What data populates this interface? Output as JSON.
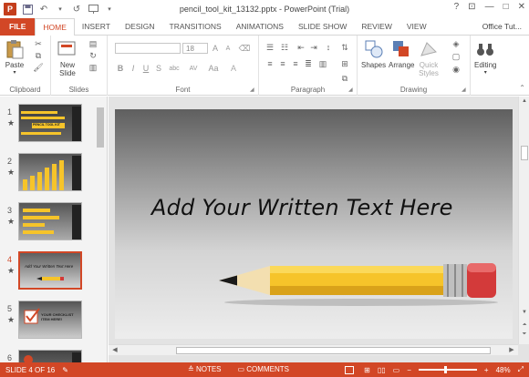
{
  "window": {
    "title": "pencil_tool_kit_13132.pptx - PowerPoint (Trial)",
    "app_logo": "P",
    "help_glyph": "?",
    "min_glyph": "—",
    "max_glyph": "□",
    "close_glyph": "✕"
  },
  "tabs": [
    {
      "label": "FILE"
    },
    {
      "label": "HOME"
    },
    {
      "label": "INSERT"
    },
    {
      "label": "DESIGN"
    },
    {
      "label": "TRANSITIONS"
    },
    {
      "label": "ANIMATIONS"
    },
    {
      "label": "SLIDE SHOW"
    },
    {
      "label": "REVIEW"
    },
    {
      "label": "VIEW"
    },
    {
      "label": "Office Tut..."
    }
  ],
  "ribbon": {
    "clipboard": {
      "group_label": "Clipboard",
      "paste_label": "Paste"
    },
    "slides": {
      "group_label": "Slides",
      "new_slide_label": "New",
      "new_slide_label2": "Slide"
    },
    "font": {
      "group_label": "Font",
      "font_size": "18",
      "bold": "B",
      "italic": "I",
      "underline": "U",
      "strike": "S",
      "shadow": "abc",
      "spacing": "AV",
      "case": "Aa",
      "grow": "A",
      "shrink": "A",
      "color": "A"
    },
    "paragraph": {
      "group_label": "Paragraph"
    },
    "drawing": {
      "group_label": "Drawing",
      "shapes_label": "Shapes",
      "arrange_label": "Arrange",
      "quick_styles_label": "Quick",
      "quick_styles_label2": "Styles"
    },
    "editing": {
      "editing_label": "Editing"
    }
  },
  "thumbnails": [
    {
      "num": "1",
      "star": "★",
      "caption": "PENCIL TOOL KIT",
      "selected": false
    },
    {
      "num": "2",
      "star": "★",
      "caption": "",
      "selected": false
    },
    {
      "num": "3",
      "star": "★",
      "caption": "",
      "selected": false
    },
    {
      "num": "4",
      "star": "★",
      "caption": "Add Your Written Text Here",
      "selected": true
    },
    {
      "num": "5",
      "star": "★",
      "caption": "YOUR CHECKLIST ITEM HERE!",
      "selected": false
    },
    {
      "num": "6",
      "star": "★",
      "caption": "",
      "selected": false
    }
  ],
  "slide": {
    "title": "Add Your Written Text Here"
  },
  "statusbar": {
    "slide_info": "SLIDE 4 OF 16",
    "notes_label": "NOTES",
    "comments_label": "COMMENTS",
    "zoom_minus": "−",
    "zoom_plus": "+",
    "zoom": "48%"
  },
  "colors": {
    "accent": "#d24726",
    "pencil_body": "#f6c42a",
    "pencil_tip": "#222222",
    "eraser": "#d33a3a"
  }
}
